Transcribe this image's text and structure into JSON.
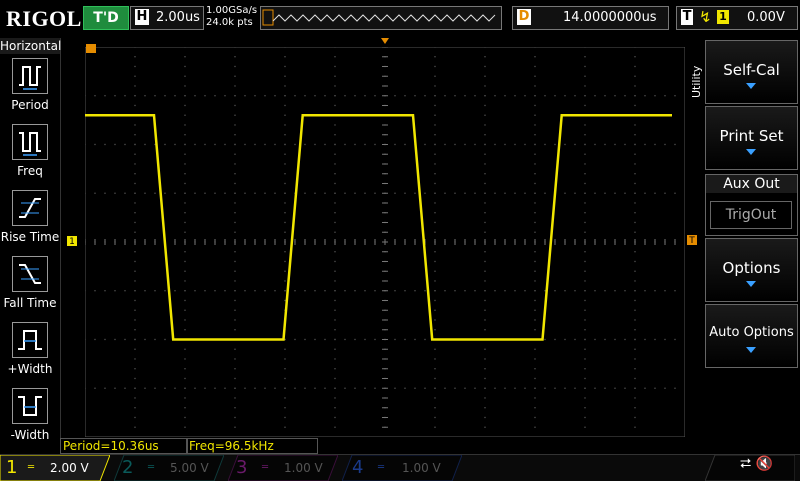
{
  "topbar": {
    "brand": "RIGOL",
    "trigger_status": "T'D",
    "timebase_label": "H",
    "timebase_value": "2.00us",
    "sample_rate": "1.00GSa/s",
    "memory_points": "24.0k pts",
    "delay_label": "D",
    "delay_value": "14.0000000us",
    "trigger_label": "T",
    "trigger_channel": "1",
    "trigger_level": "0.00V"
  },
  "left_menu": {
    "title": "Horizontal",
    "items": [
      {
        "label": "Period",
        "icon": "period-icon"
      },
      {
        "label": "Freq",
        "icon": "frequency-icon"
      },
      {
        "label": "Rise Time",
        "icon": "rise-time-icon"
      },
      {
        "label": "Fall Time",
        "icon": "fall-time-icon"
      },
      {
        "label": "+Width",
        "icon": "positive-width-icon"
      },
      {
        "label": "-Width",
        "icon": "negative-width-icon"
      }
    ]
  },
  "right_menu": {
    "side_label": "Utility",
    "softkeys": [
      {
        "label": "Self-Cal"
      },
      {
        "label": "Print Set"
      },
      {
        "label": "Options"
      },
      {
        "label": "Auto Options"
      }
    ],
    "aux_out": {
      "title": "Aux Out",
      "value": "TrigOut"
    }
  },
  "measurements": {
    "period": "Period=10.36us",
    "freq": "Freq=96.5kHz"
  },
  "channels": [
    {
      "num": "1",
      "scale": "2.00 V",
      "color": "#f1e600",
      "active": true
    },
    {
      "num": "2",
      "scale": "5.00 V",
      "color": "#00c0c0",
      "active": false
    },
    {
      "num": "3",
      "scale": "1.00 V",
      "color": "#e030e0",
      "active": false
    },
    {
      "num": "4",
      "scale": "1.00 V",
      "color": "#2a6cff",
      "active": false
    }
  ],
  "waveform": {
    "channel": "1",
    "high_level_div": 2.6,
    "low_level_div": -2.0,
    "period_us": 10.36,
    "color": "#f1e600"
  }
}
